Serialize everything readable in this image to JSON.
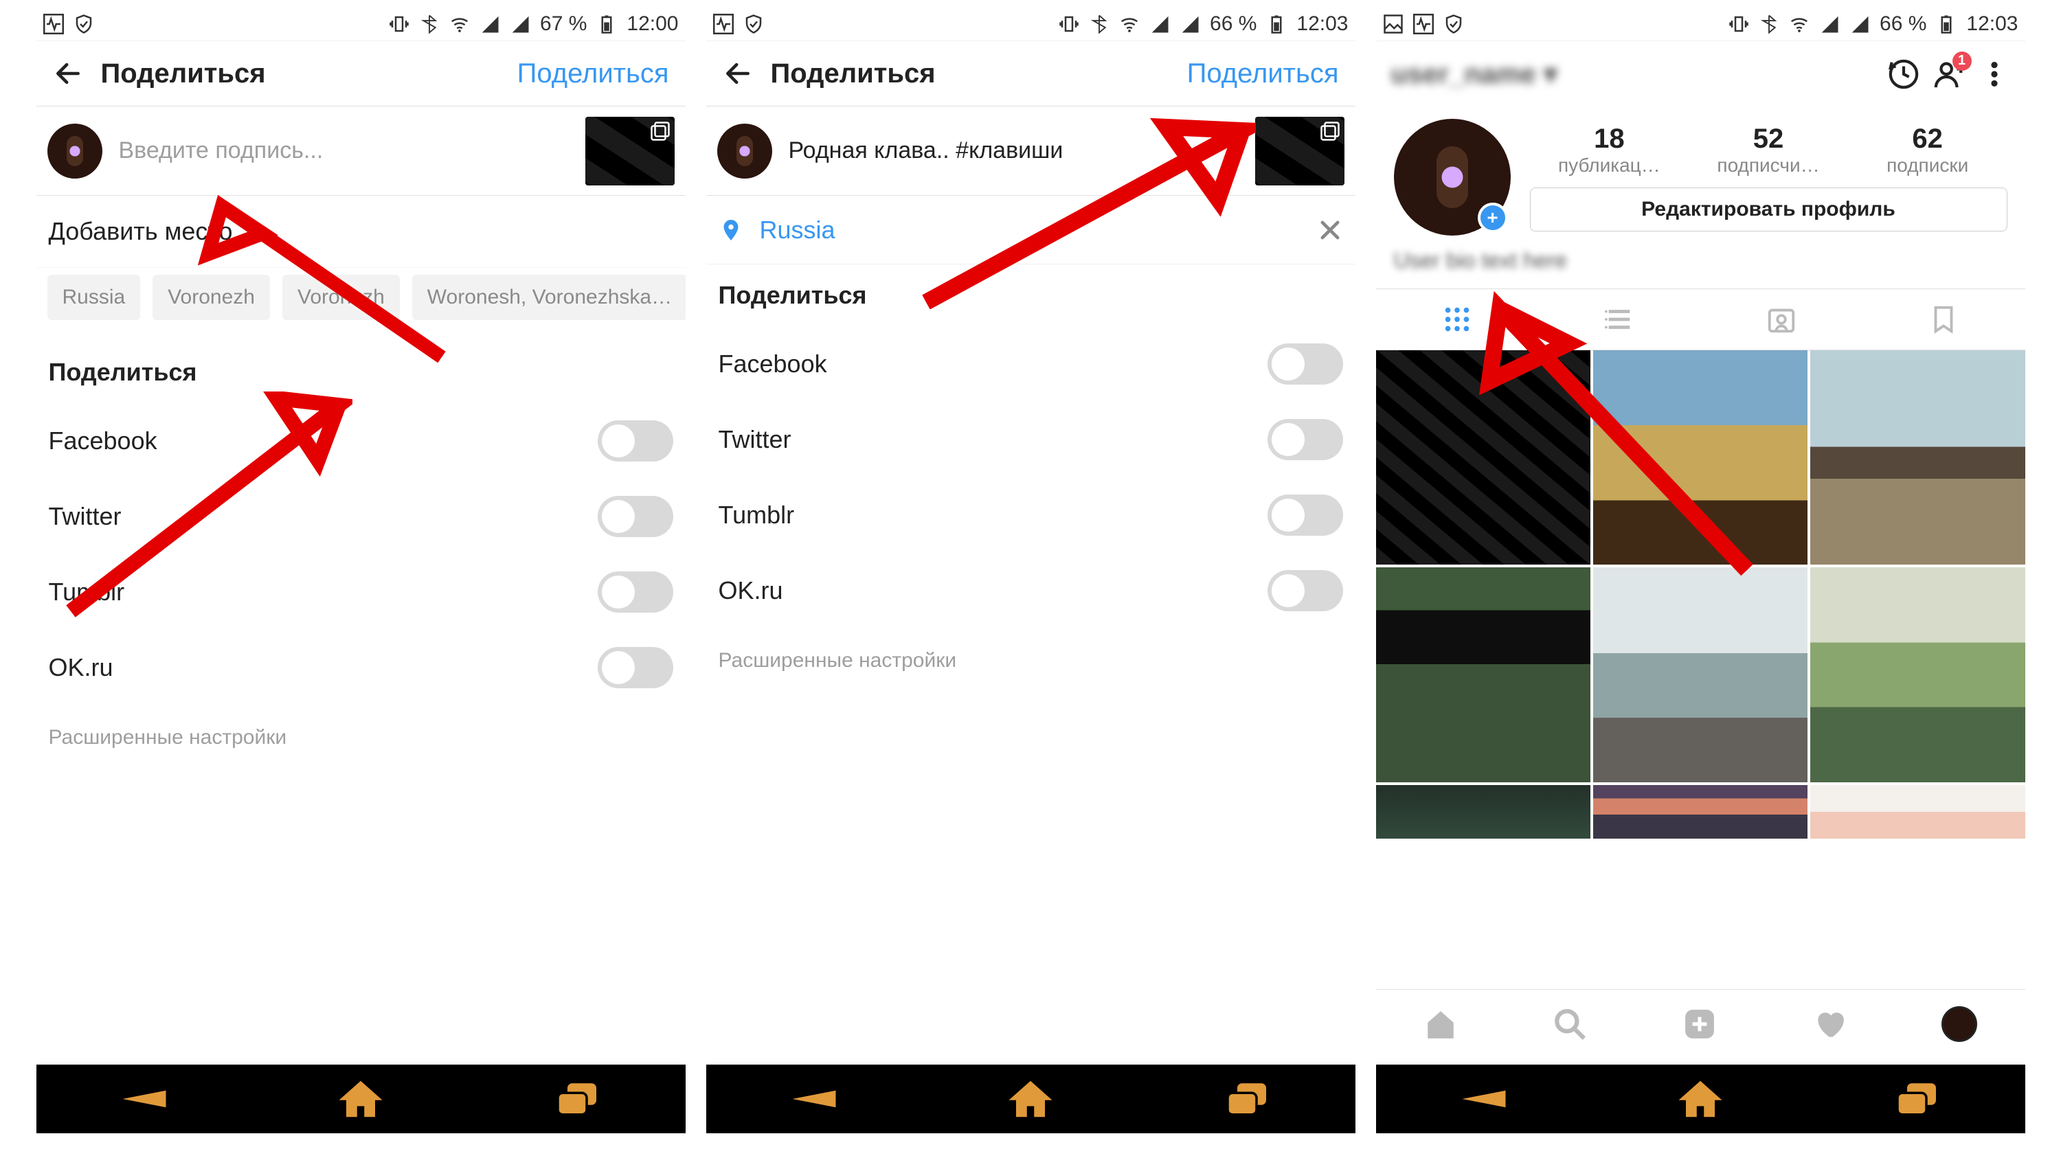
{
  "status": {
    "battery1": "67 %",
    "time1": "12:00",
    "battery2": "66 %",
    "time2": "12:03",
    "battery3": "66 %",
    "time3": "12:03"
  },
  "s1": {
    "header_title": "Поделиться",
    "header_action": "Поделиться",
    "caption_placeholder": "Введите подпись...",
    "add_location": "Добавить место",
    "chips": [
      "Russia",
      "Voronezh",
      "Voronezh",
      "Woronesh, Voronezhska…"
    ],
    "share_title": "Поделиться",
    "networks": [
      "Facebook",
      "Twitter",
      "Tumblr",
      "OK.ru"
    ],
    "advanced": "Расширенные настройки"
  },
  "s2": {
    "header_title": "Поделиться",
    "header_action": "Поделиться",
    "caption_text": "Родная клава.. #клавиши",
    "location": "Russia",
    "share_title": "Поделиться",
    "networks": [
      "Facebook",
      "Twitter",
      "Tumblr",
      "OK.ru"
    ],
    "advanced": "Расширенные настройки"
  },
  "s3": {
    "username": "user_name ▾",
    "notif_count": "1",
    "stats": {
      "posts": {
        "n": "18",
        "l": "публикац…"
      },
      "followers": {
        "n": "52",
        "l": "подписчи…"
      },
      "following": {
        "n": "62",
        "l": "подписки"
      }
    },
    "edit_profile": "Редактировать профиль",
    "bio": "User bio text here"
  }
}
